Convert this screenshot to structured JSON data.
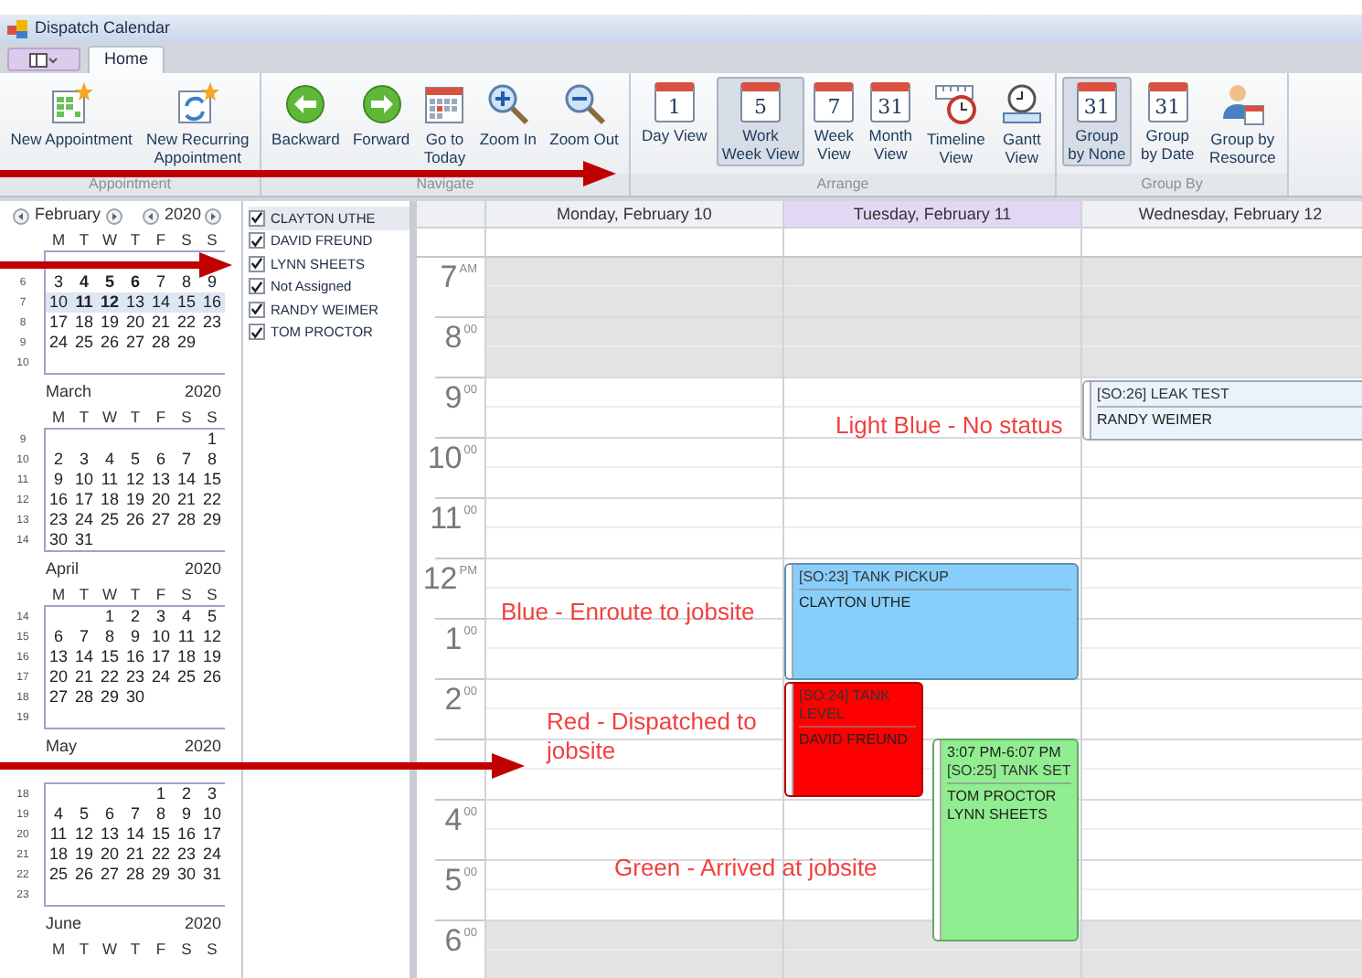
{
  "window": {
    "title": "Dispatch Calendar"
  },
  "tabs": [
    {
      "label": "Home",
      "selected": true
    }
  ],
  "ribbon": {
    "groups": [
      {
        "label": "Appointment",
        "buttons": [
          {
            "kind": "new-appointment",
            "label": "New Appointment",
            "selected": false
          },
          {
            "kind": "new-recurring",
            "label": "New Recurring\nAppointment",
            "selected": false
          }
        ]
      },
      {
        "label": "Navigate",
        "buttons": [
          {
            "kind": "backward",
            "label": "Backward",
            "selected": false
          },
          {
            "kind": "forward",
            "label": "Forward",
            "selected": false
          },
          {
            "kind": "today",
            "label": "Go to\nToday",
            "selected": false
          },
          {
            "kind": "zoom-in",
            "label": "Zoom In",
            "selected": false
          },
          {
            "kind": "zoom-out",
            "label": "Zoom Out",
            "selected": false
          }
        ]
      },
      {
        "label": "Arrange",
        "buttons": [
          {
            "kind": "calendar",
            "icon_text": "1",
            "label": "Day View",
            "selected": false
          },
          {
            "kind": "calendar",
            "icon_text": "5",
            "label": "Work\nWeek View",
            "selected": true
          },
          {
            "kind": "calendar",
            "icon_text": "7",
            "label": "Week\nView",
            "selected": false
          },
          {
            "kind": "calendar",
            "icon_text": "31",
            "label": "Month\nView",
            "selected": false
          },
          {
            "kind": "timeline",
            "label": "Timeline\nView",
            "selected": false
          },
          {
            "kind": "gantt",
            "label": "Gantt\nView",
            "selected": false
          }
        ]
      },
      {
        "label": "Group By",
        "buttons": [
          {
            "kind": "calendar",
            "icon_text": "31",
            "label": "Group\nby None",
            "selected": true
          },
          {
            "kind": "group-date",
            "icon_text": "31",
            "label": "Group\nby Date",
            "selected": false
          },
          {
            "kind": "group-resource",
            "label": "Group by\nResource",
            "selected": false
          }
        ]
      }
    ]
  },
  "mini_calendar": {
    "months": [
      {
        "name": "February",
        "year": "2020",
        "navigation": true,
        "weekdays": [
          "M",
          "T",
          "W",
          "T",
          "F",
          "S",
          "S"
        ],
        "weeks": [
          {
            "selected": false
          },
          {
            "number": "6",
            "selected": false,
            "days": [
              {
                "day": "3",
                "bold": false
              },
              {
                "day": "4",
                "bold": true
              },
              {
                "day": "5",
                "bold": true
              },
              {
                "day": "6",
                "bold": true
              },
              {
                "day": "7",
                "bold": false
              },
              {
                "day": "8",
                "bold": false
              },
              {
                "day": "9",
                "bold": false
              }
            ]
          },
          {
            "number": "7",
            "selected": true,
            "days": [
              {
                "day": "10",
                "bold": false
              },
              {
                "day": "11",
                "bold": true
              },
              {
                "day": "12",
                "bold": true
              },
              {
                "day": "13",
                "bold": false
              },
              {
                "day": "14",
                "bold": false
              },
              {
                "day": "15",
                "bold": false
              },
              {
                "day": "16",
                "bold": false
              }
            ]
          },
          {
            "number": "8",
            "selected": false,
            "days": [
              {
                "day": "17",
                "bold": false
              },
              {
                "day": "18",
                "bold": false
              },
              {
                "day": "19",
                "bold": false
              },
              {
                "day": "20",
                "bold": false
              },
              {
                "day": "21",
                "bold": false
              },
              {
                "day": "22",
                "bold": false
              },
              {
                "day": "23",
                "bold": false
              }
            ]
          },
          {
            "number": "9",
            "selected": false,
            "days": [
              {
                "day": "24",
                "bold": false
              },
              {
                "day": "25",
                "bold": false
              },
              {
                "day": "26",
                "bold": false
              },
              {
                "day": "27",
                "bold": false
              },
              {
                "day": "28",
                "bold": false
              },
              {
                "day": "29",
                "bold": false
              }
            ]
          },
          {
            "number": "10",
            "selected": false
          }
        ]
      },
      {
        "name": "March",
        "year": "2020",
        "weekdays": [
          "M",
          "T",
          "W",
          "T",
          "F",
          "S",
          "S"
        ],
        "weeks": [
          {
            "number": "9",
            "selected": false,
            "align_end": true,
            "days": [
              "1"
            ]
          },
          {
            "number": "10",
            "selected": false,
            "days": [
              "2",
              "3",
              "4",
              "5",
              "6",
              "7",
              "8"
            ]
          },
          {
            "number": "11",
            "selected": false,
            "days": [
              "9",
              "10",
              "11",
              "12",
              "13",
              "14",
              "15"
            ]
          },
          {
            "number": "12",
            "selected": false,
            "days": [
              "16",
              "17",
              "18",
              "19",
              "20",
              "21",
              "22"
            ]
          },
          {
            "number": "13",
            "selected": false,
            "days": [
              "23",
              "24",
              "25",
              "26",
              "27",
              "28",
              "29"
            ]
          },
          {
            "number": "14",
            "selected": false,
            "days": [
              "30",
              "31"
            ]
          }
        ]
      },
      {
        "name": "April",
        "year": "2020",
        "weekdays": [
          "M",
          "T",
          "W",
          "T",
          "F",
          "S",
          "S"
        ],
        "weeks": [
          {
            "number": "14",
            "selected": false,
            "align_end": true,
            "days": [
              "1",
              "2",
              "3",
              "4",
              "5"
            ]
          },
          {
            "number": "15",
            "selected": false,
            "days": [
              "6",
              "7",
              "8",
              "9",
              "10",
              "11",
              "12"
            ]
          },
          {
            "number": "16",
            "selected": false,
            "days": [
              "13",
              "14",
              "15",
              "16",
              "17",
              "18",
              "19"
            ]
          },
          {
            "number": "17",
            "selected": false,
            "days": [
              "20",
              "21",
              "22",
              "23",
              "24",
              "25",
              "26"
            ]
          },
          {
            "number": "18",
            "selected": false,
            "days": [
              "27",
              "28",
              "29",
              "30"
            ]
          },
          {
            "number": "19",
            "selected": false
          }
        ]
      },
      {
        "name": "May",
        "year": "2020",
        "weeks": [
          {
            "number": "18",
            "selected": false,
            "align_end": true,
            "days": [
              "1",
              "2",
              "3"
            ]
          },
          {
            "number": "19",
            "selected": false,
            "days": [
              "4",
              "5",
              "6",
              "7",
              "8",
              "9",
              "10"
            ]
          },
          {
            "number": "20",
            "selected": false,
            "days": [
              "11",
              "12",
              "13",
              "14",
              "15",
              "16",
              "17"
            ]
          },
          {
            "number": "21",
            "selected": false,
            "days": [
              "18",
              "19",
              "20",
              "21",
              "22",
              "23",
              "24"
            ]
          },
          {
            "number": "22",
            "selected": false,
            "days": [
              "25",
              "26",
              "27",
              "28",
              "29",
              "30",
              "31"
            ]
          },
          {
            "number": "23",
            "selected": false
          }
        ]
      },
      {
        "name": "June",
        "year": "2020",
        "weekdays": [
          "M",
          "T",
          "W",
          "T",
          "F",
          "S",
          "S"
        ]
      }
    ]
  },
  "resources": [
    {
      "name": "CLAYTON UTHE",
      "checked": true,
      "selected": true
    },
    {
      "name": "DAVID FREUND",
      "checked": true,
      "selected": false
    },
    {
      "name": "LYNN SHEETS",
      "checked": true,
      "selected": false
    },
    {
      "name": "Not Assigned",
      "checked": true,
      "selected": false
    },
    {
      "name": "RANDY WEIMER",
      "checked": true,
      "selected": false
    },
    {
      "name": "TOM PROCTOR",
      "checked": true,
      "selected": false
    }
  ],
  "calendar": {
    "hours": [
      {
        "hour": "7",
        "suffix": "AM",
        "working": false
      },
      {
        "hour": "8",
        "suffix": "00",
        "working": false
      },
      {
        "hour": "9",
        "suffix": "00",
        "working": true
      },
      {
        "hour": "10",
        "suffix": "00",
        "working": true
      },
      {
        "hour": "11",
        "suffix": "00",
        "working": true
      },
      {
        "hour": "12",
        "suffix": "PM",
        "working": true
      },
      {
        "hour": "1",
        "suffix": "00",
        "working": true
      },
      {
        "hour": "2",
        "suffix": "00",
        "working": true
      },
      {
        "working": true
      },
      {
        "hour": "4",
        "suffix": "00",
        "working": true
      },
      {
        "hour": "5",
        "suffix": "00",
        "working": true
      },
      {
        "hour": "6",
        "suffix": "00",
        "working": false
      }
    ],
    "days": [
      {
        "label": "Monday, February 10",
        "today": false
      },
      {
        "label": "Tuesday, February 11",
        "today": true,
        "appointments": [
          {
            "title": "[SO:23] TANK PICKUP",
            "people": [
              "CLAYTON UTHE"
            ],
            "color": "#87cefa"
          },
          {
            "title": "[SO:24] TANK LEVEL",
            "people": [
              "DAVID FREUND"
            ],
            "color": "#ff0000"
          },
          {
            "time": "3:07 PM-6:07 PM",
            "title": "[SO:25] TANK SET",
            "people": [
              "TOM PROCTOR",
              "LYNN SHEETS"
            ],
            "color": "#90ee90"
          }
        ]
      },
      {
        "label": "Wednesday, February 12",
        "today": false,
        "appointments": [
          {
            "title": "[SO:26] LEAK TEST",
            "people": [
              "RANDY WEIMER"
            ],
            "color": "#eaf3fb"
          }
        ]
      }
    ]
  },
  "annotations": [
    {
      "text": "Light Blue - No status"
    },
    {
      "text": "Blue - Enroute to jobsite"
    },
    {
      "text": "Red - Dispatched to\njobsite"
    },
    {
      "text": "Green - Arrived at jobsite"
    }
  ]
}
